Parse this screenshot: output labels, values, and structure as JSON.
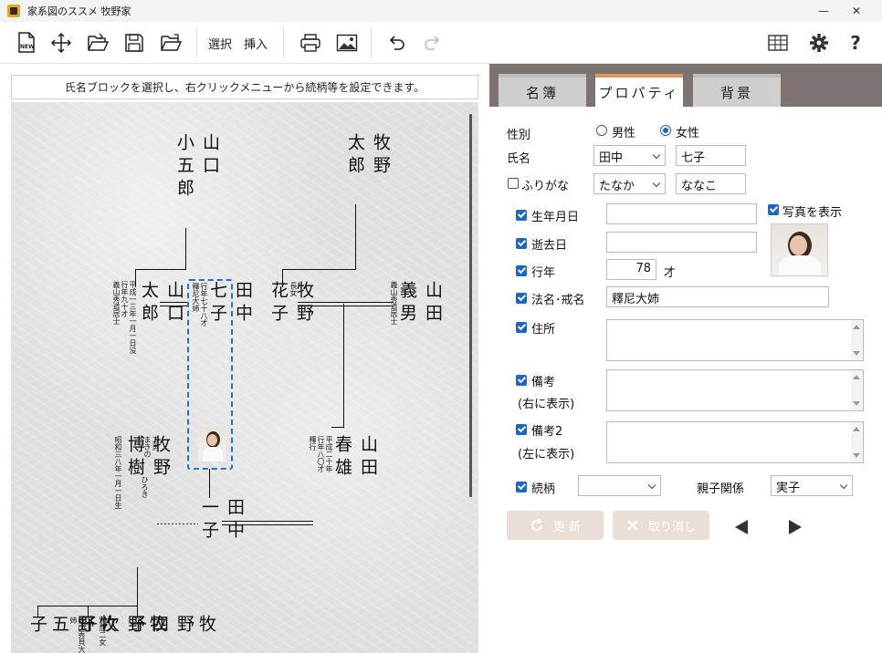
{
  "window": {
    "title": "家系図のススメ 牧野家",
    "minimize": "—",
    "maximize": "☐",
    "close": "✕"
  },
  "toolbar": {
    "select_label": "選択",
    "insert_label": "挿入"
  },
  "canvas": {
    "hint": "氏名ブロックを選択し、右クリックメニューから続柄等を設定できます。",
    "people": {
      "yamaguchi_koguro": {
        "surname": "山口",
        "given": "小五郎"
      },
      "makino_taro": {
        "surname": "牧野",
        "given": "太郎"
      },
      "yamaguchi_taro": {
        "surname": "山口",
        "given": "太郎",
        "note1": "平成一三年一月一日没",
        "note2": "行年九十才",
        "note3": "義山秀道居士"
      },
      "tanaka_nanako": {
        "surname": "田中",
        "given": "七子",
        "note1": "行年七十八才",
        "note2": "釋尼大姉"
      },
      "makino_hanako": {
        "surname": "牧野",
        "given": "花子",
        "note1": "長女"
      },
      "yamada_yoshio": {
        "surname": "山田",
        "given": "義男",
        "note1": "義山秀道居士"
      },
      "makino_hiroki": {
        "surname": "牧野",
        "given": "博樹",
        "note1": "二男",
        "note2": "まきの",
        "note3": "昭和三八年一月一日生",
        "reading": "ひろき"
      },
      "tanaka_kazuko": {
        "surname": "田中",
        "given": "一子"
      },
      "yamada_haruo": {
        "surname": "山田",
        "given": "春雄",
        "note1": "平成二十年",
        "note2": "行年八〇才",
        "note3": "釋行"
      },
      "makino_goko": {
        "surname": "牧野",
        "given": "五子"
      },
      "makino_tsugiko": {
        "surname": "牧野",
        "given": "次子",
        "note1": "養山秀貝大姉",
        "note2": "別居二女"
      },
      "makino_yonko": {
        "surname": "牧野",
        "given": "四子"
      }
    }
  },
  "tabs": [
    {
      "label": "名簿"
    },
    {
      "label": "プロパティ"
    },
    {
      "label": "背景"
    }
  ],
  "form": {
    "gender_label": "性別",
    "male_label": "男性",
    "female_label": "女性",
    "name_label": "氏名",
    "surname_value": "田中",
    "given_value": "七子",
    "furigana_label": "ふりがな",
    "surname_kana": "たなか",
    "given_kana": "ななこ",
    "birth_label": "生年月日",
    "show_photo_label": "写真を表示",
    "death_label": "逝去日",
    "age_label": "行年",
    "age_value": "78",
    "age_unit": "才",
    "posthumous_label": "法名･戒名",
    "posthumous_value": "釋尼大姉",
    "address_label": "住所",
    "note_label": "備考",
    "note_sub": "(右に表示)",
    "note2_label": "備考2",
    "note2_sub": "(左に表示)",
    "relation_label": "続柄",
    "relation_value": "",
    "parent_label": "親子関係",
    "parent_value": "実子",
    "update_label": "更 新",
    "cancel_label": "取り消し"
  },
  "colors": {
    "accent": "#1a67c8",
    "tab_active_border": "#e8935a",
    "tab_strip": "#7d7370",
    "selection": "#2a6fd8"
  }
}
